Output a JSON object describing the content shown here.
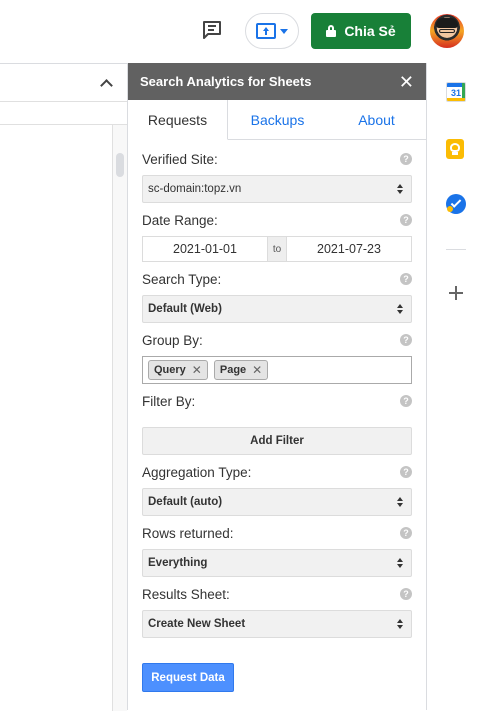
{
  "topbar": {
    "share_label": "Chia Sẻ",
    "icons": [
      "comment-icon",
      "present-icon",
      "lock-icon",
      "avatar"
    ]
  },
  "sidebar": {
    "title": "Search Analytics for Sheets",
    "close_symbol": "✕",
    "tabs": [
      {
        "label": "Requests",
        "active": true
      },
      {
        "label": "Backups",
        "active": false
      },
      {
        "label": "About",
        "active": false
      }
    ],
    "help_symbol": "?",
    "verified_site": {
      "label": "Verified Site:",
      "value": "sc-domain:topz.vn"
    },
    "date_range": {
      "label": "Date Range:",
      "start": "2021-01-01",
      "to": "to",
      "end": "2021-07-23"
    },
    "search_type": {
      "label": "Search Type:",
      "value": "Default (Web)"
    },
    "group_by": {
      "label": "Group By:",
      "tags": [
        "Query",
        "Page"
      ],
      "remove_symbol": "✕"
    },
    "filter_by": {
      "label": "Filter By:",
      "button": "Add Filter"
    },
    "aggregation_type": {
      "label": "Aggregation Type:",
      "value": "Default (auto)"
    },
    "rows_returned": {
      "label": "Rows returned:",
      "value": "Everything"
    },
    "results_sheet": {
      "label": "Results Sheet:",
      "value": "Create New Sheet"
    },
    "request_button": "Request Data"
  },
  "rail": {
    "calendar_day": "31",
    "icons": [
      "calendar-icon",
      "keep-icon",
      "tasks-icon",
      "add-icon"
    ]
  },
  "colors": {
    "share_green": "#188038",
    "header_gray": "#616161",
    "link_blue": "#1a73e8",
    "request_blue": "#4d90fe"
  }
}
